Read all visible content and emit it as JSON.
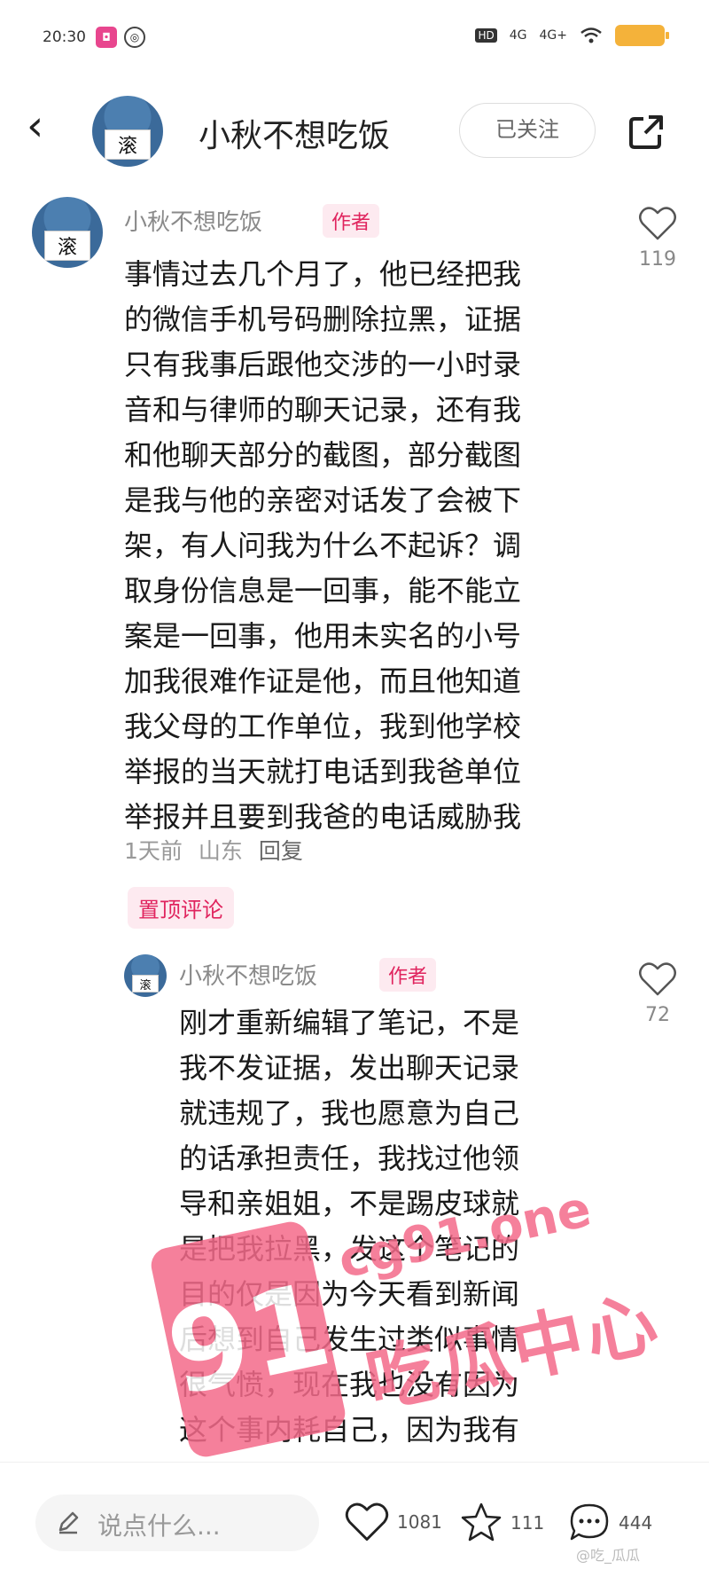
{
  "status_bar": {
    "time": "20:30",
    "signal_1": "4G",
    "signal_2": "4G+",
    "hd": "HD"
  },
  "header": {
    "username": "小秋不想吃饭",
    "follow_label": "已关注",
    "avatar_sign": "滚"
  },
  "comments": [
    {
      "username": "小秋不想吃饭",
      "tag": "作者",
      "avatar_sign": "滚",
      "lines": [
        "事情过去几个月了，他已经把我",
        "的微信手机号码删除拉黑，证据",
        "只有我事后跟他交涉的一小时录",
        "音和与律师的聊天记录，还有我",
        "和他聊天部分的截图，部分截图",
        "是我与他的亲密对话发了会被下",
        "架，有人问我为什么不起诉？调",
        "取身份信息是一回事，能不能立",
        "案是一回事，他用未实名的小号",
        "加我很难作证是他，而且他知道",
        "我父母的工作单位，我到他学校",
        "举报的当天就打电话到我爸单位",
        "举报并且要到我爸的电话威胁我"
      ],
      "time": "1天前",
      "location": "山东",
      "reply_label": "回复",
      "likes": "119",
      "pinned_label": "置顶评论"
    },
    {
      "username": "小秋不想吃饭",
      "tag": "作者",
      "avatar_sign": "滚",
      "lines": [
        "刚才重新编辑了笔记，不是",
        "我不发证据，发出聊天记录",
        "就违规了，我也愿意为自己",
        "的话承担责任，我找过他领",
        "导和亲姐姐，不是踢皮球就",
        "是把我拉黑，发这个笔记的",
        "目的仅是因为今天看到新闻",
        "后想到自己发生过类似事情",
        "很气愤，现在我也没有因为",
        "这个事内耗自己，因为我有"
      ],
      "likes": "72"
    }
  ],
  "bottom_bar": {
    "input_placeholder": "说点什么...",
    "like_count": "1081",
    "star_count": "111",
    "comment_count": "444"
  },
  "watermark": {
    "logo": "91",
    "site": "cg91.one",
    "cn": "吃瓜中心",
    "small": "@吃_瓜瓜"
  }
}
